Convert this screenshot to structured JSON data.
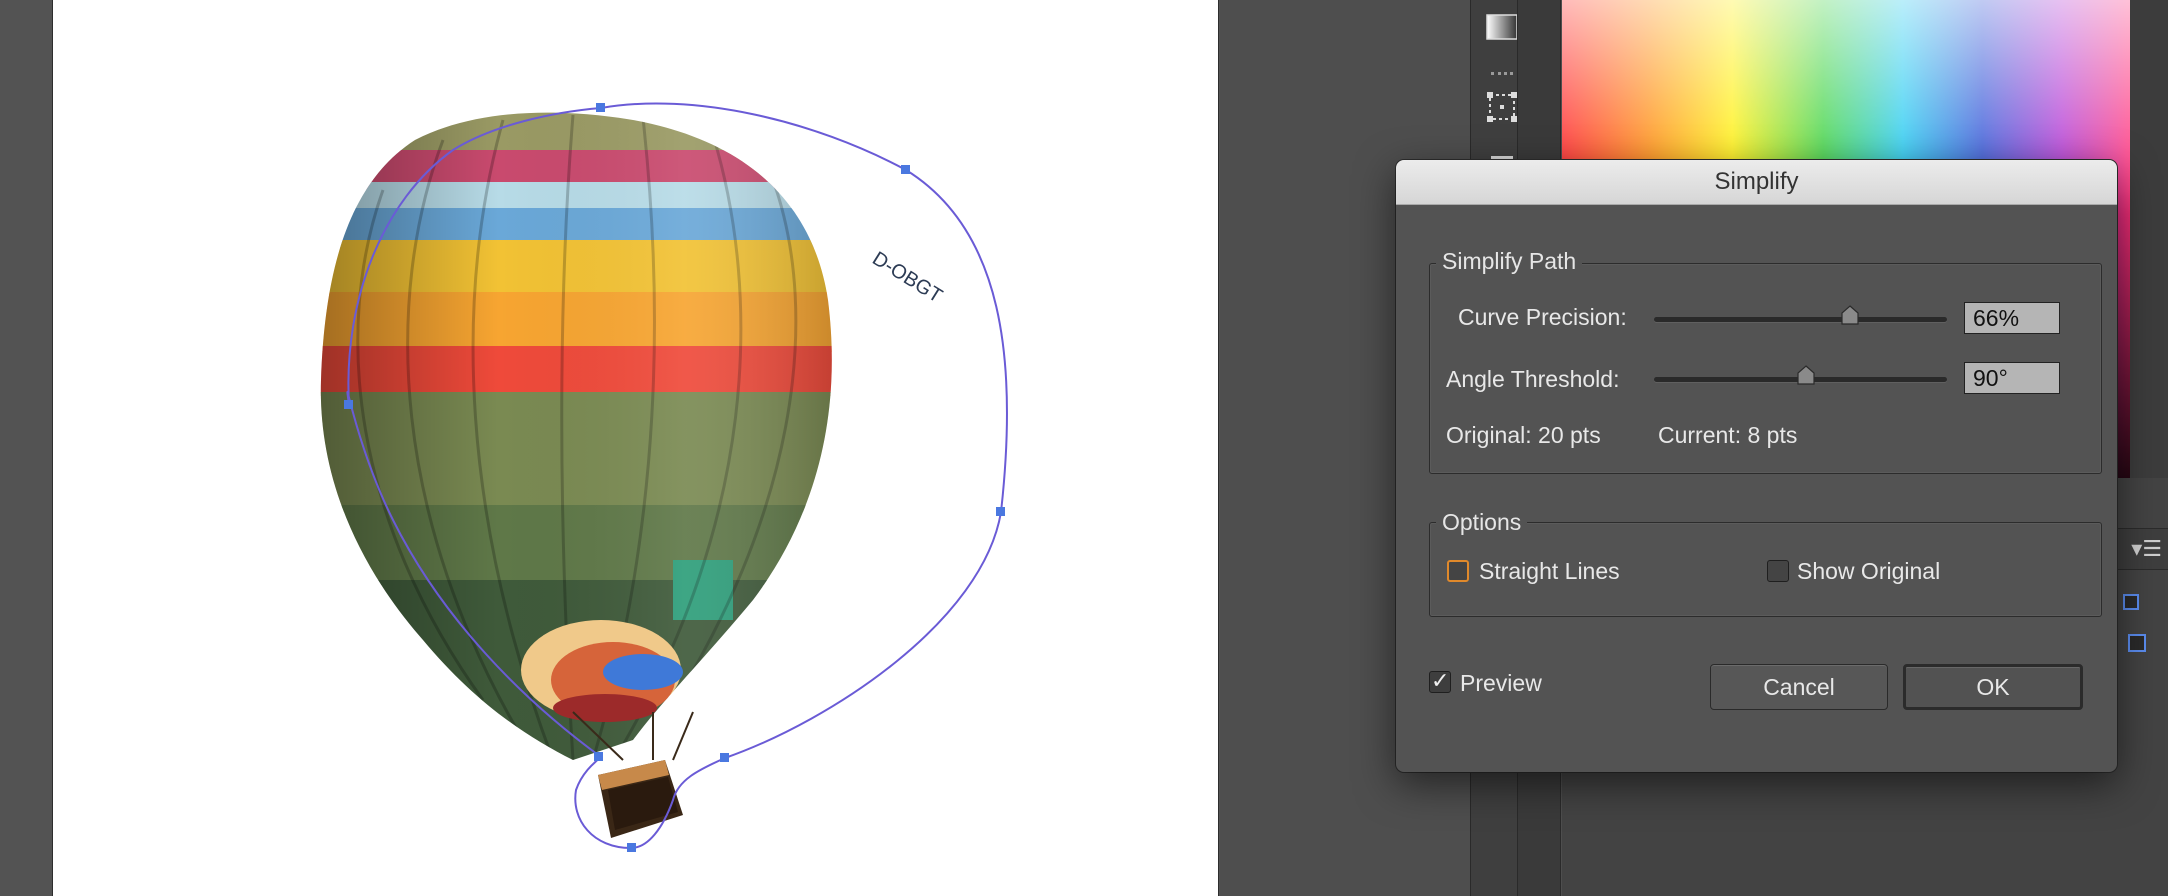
{
  "dialog": {
    "title": "Simplify",
    "simplify_path": {
      "group_label": "Simplify Path",
      "curve_precision_label": "Curve Precision:",
      "curve_precision_value": "66%",
      "curve_precision_fraction": 0.66,
      "angle_threshold_label": "Angle Threshold:",
      "angle_threshold_value": "90°",
      "angle_threshold_fraction": 0.5,
      "original_text": "Original: 20 pts",
      "current_text": "Current: 8 pts"
    },
    "options": {
      "group_label": "Options",
      "straight_lines_label": "Straight Lines",
      "straight_lines_checked": false,
      "show_original_label": "Show Original",
      "show_original_checked": false
    },
    "preview_label": "Preview",
    "preview_checked": true,
    "cancel_label": "Cancel",
    "ok_label": "OK"
  },
  "canvas": {
    "balloon_registration": "D-OBGT",
    "path_color": "#6a5bd6",
    "anchor_color": "#4a78e0"
  },
  "colors": {
    "workspace": "#535353",
    "dialog_bg": "#535353",
    "focus_ring": "#e0892b"
  },
  "icons": {
    "gradient_tool": "gradient-icon",
    "transform_tool": "transform-icon",
    "panel_menu": "hamburger-menu-icon"
  }
}
